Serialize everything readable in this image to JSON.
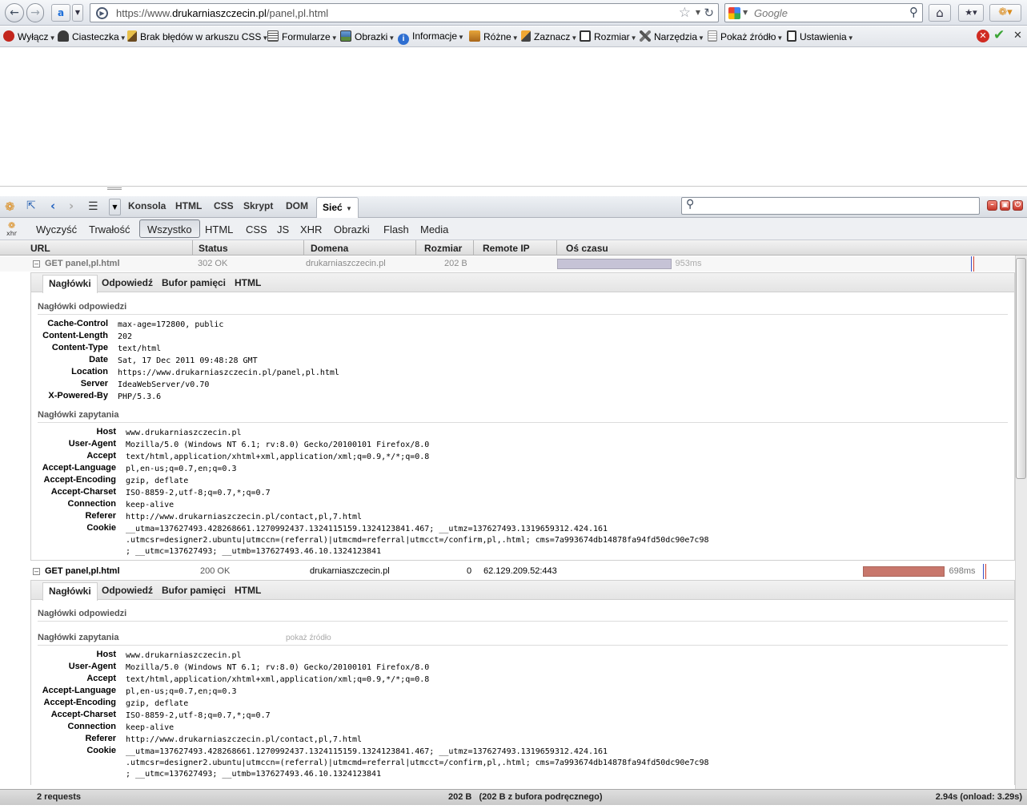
{
  "browser": {
    "url_prefix": "https://www.",
    "url_domain": "drukarniaszczecin.pl",
    "url_path": "/panel,pl.html",
    "search_placeholder": "Google"
  },
  "webdev_toolbar": {
    "items": [
      "Wyłącz",
      "Ciasteczka",
      "Brak błędów w arkuszu CSS",
      "Formularze",
      "Obrazki",
      "Informacje",
      "Różne",
      "Zaznacz",
      "Rozmiar",
      "Narzędzia",
      "Pokaż źródło",
      "Ustawienia"
    ]
  },
  "firebug": {
    "tabs": [
      "Konsola",
      "HTML",
      "CSS",
      "Skrypt",
      "DOM",
      "Sieć"
    ],
    "selected_tab": "Sieć",
    "filters": [
      "Wyczyść",
      "Trwałość",
      "Wszystko",
      "HTML",
      "CSS",
      "JS",
      "XHR",
      "Obrazki",
      "Flash",
      "Media"
    ],
    "selected_filter": "Wszystko",
    "columns": [
      "URL",
      "Status",
      "Domena",
      "Rozmiar",
      "Remote IP",
      "Oś czasu"
    ],
    "detail_tabs": [
      "Nagłówki",
      "Odpowiedź",
      "Bufor pamięci",
      "HTML"
    ],
    "requests": [
      {
        "url": "GET panel,pl.html",
        "status": "302 OK",
        "domain": "drukarniaszczecin.pl",
        "size": "202 B",
        "remote_ip": "",
        "time": "953ms",
        "timeline_start": 0.0,
        "timeline_fraction": 0.25
      },
      {
        "url": "GET panel,pl.html",
        "status": "200 OK",
        "domain": "drukarniaszczecin.pl",
        "size": "0",
        "remote_ip": "62.129.209.52:443",
        "time": "698ms",
        "timeline_start": 0.67,
        "timeline_fraction": 0.18
      }
    ],
    "response_headers_title": "Nagłówki odpowiedzi",
    "request_headers_title": "Nagłówki zapytania",
    "show_source_link": "pokaż źródło",
    "response_headers": [
      [
        "Cache-Control",
        "max-age=172800, public"
      ],
      [
        "Content-Length",
        "202"
      ],
      [
        "Content-Type",
        "text/html"
      ],
      [
        "Date",
        "Sat, 17 Dec 2011 09:48:28 GMT"
      ],
      [
        "Location",
        "https://www.drukarniaszczecin.pl/panel,pl.html"
      ],
      [
        "Server",
        "IdeaWebServer/v0.70"
      ],
      [
        "X-Powered-By",
        "PHP/5.3.6"
      ]
    ],
    "request_headers": [
      [
        "Host",
        "www.drukarniaszczecin.pl"
      ],
      [
        "User-Agent",
        "Mozilla/5.0 (Windows NT 6.1; rv:8.0) Gecko/20100101 Firefox/8.0"
      ],
      [
        "Accept",
        "text/html,application/xhtml+xml,application/xml;q=0.9,*/*;q=0.8"
      ],
      [
        "Accept-Language",
        "pl,en-us;q=0.7,en;q=0.3"
      ],
      [
        "Accept-Encoding",
        "gzip, deflate"
      ],
      [
        "Accept-Charset",
        "ISO-8859-2,utf-8;q=0.7,*;q=0.7"
      ],
      [
        "Connection",
        "keep-alive"
      ],
      [
        "Referer",
        "http://www.drukarniaszczecin.pl/contact,pl,7.html"
      ],
      [
        "Cookie",
        "__utma=137627493.428268661.1270992437.1324115159.1324123841.467; __utmz=137627493.1319659312.424.161\n.utmcsr=designer2.ubuntu|utmccn=(referral)|utmcmd=referral|utmcct=/confirm,pl,.html; cms=7a993674db14878fa94fd50dc90e7c98\n; __utmc=137627493; __utmb=137627493.46.10.1324123841"
      ]
    ],
    "status_bar": {
      "requests": "2 requests",
      "size": "202 B   (202 B z bufora podręcznego)",
      "timing": "2.94s (onload: 3.29s)"
    },
    "colors": {
      "bar_cached": "#c6c3d6",
      "bar_loaded": "#c8776c"
    }
  }
}
